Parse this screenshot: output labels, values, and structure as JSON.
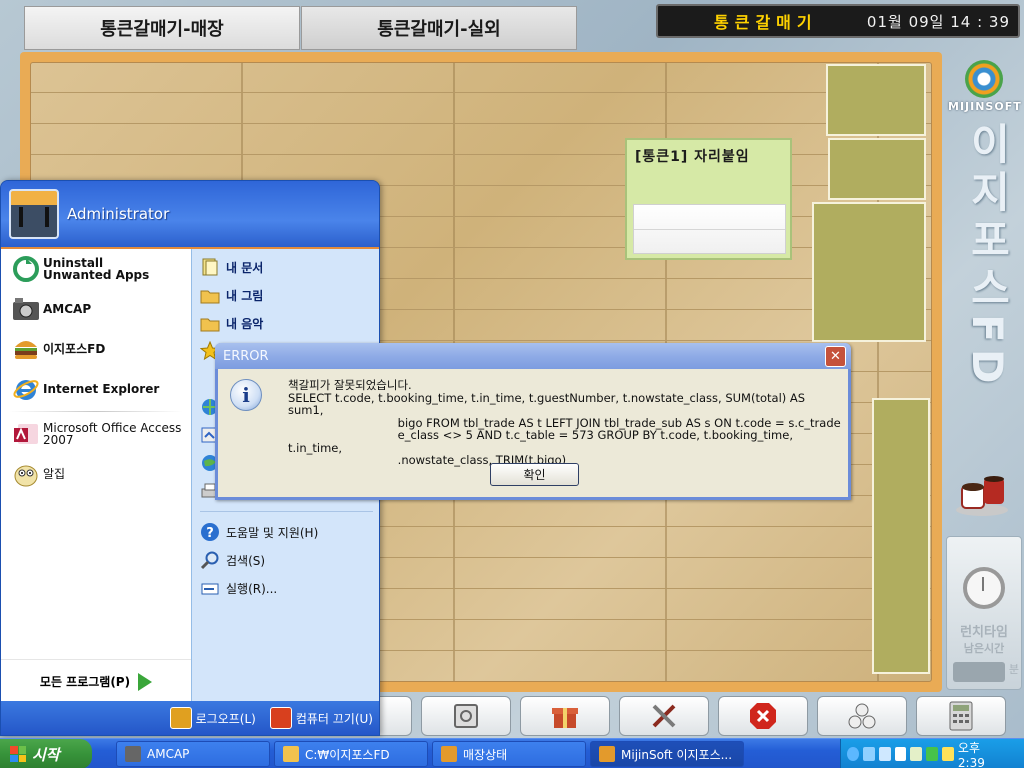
{
  "app": {
    "tabs": [
      "통큰갈매기-매장",
      "통큰갈매기-실외"
    ],
    "clock": {
      "store_name": "통큰갈매기",
      "date_time": "01월 09일  14 : 39"
    },
    "table": {
      "title": "[통큰1]   자리붙임"
    },
    "brand": {
      "name": "MIJINSOFT",
      "vertical_title": "이지포스FD"
    },
    "lunch": {
      "title": "런치타임",
      "subtitle": "남은시간",
      "unit": "분"
    },
    "toolbar_icons": [
      "box-icon",
      "safe-icon",
      "gift-icon",
      "tools-icon",
      "cancel-icon",
      "people-icon",
      "calculator-icon"
    ]
  },
  "start_menu": {
    "user": "Administrator",
    "left_items": [
      {
        "label": "Uninstall Unwanted Apps",
        "icon": "uninstall-icon"
      },
      {
        "label": "AMCAP",
        "icon": "camera-icon"
      },
      {
        "label": "이지포스FD",
        "icon": "burger-icon"
      },
      {
        "label": "Internet Explorer",
        "icon": "ie-icon"
      },
      {
        "label": "Microsoft Office Access 2007",
        "icon": "access-icon"
      },
      {
        "label": "알집",
        "icon": "alzip-icon"
      }
    ],
    "all_programs": "모든 프로그램(P)",
    "right_items": [
      {
        "label": "내 문서",
        "icon": "documents-icon"
      },
      {
        "label": "내 그림",
        "icon": "pictures-icon"
      },
      {
        "label": "내 음악",
        "icon": "music-icon"
      },
      {
        "label": "도움말 및 지원(H)",
        "icon": "help-icon"
      },
      {
        "label": "검색(S)",
        "icon": "search-icon"
      },
      {
        "label": "실행(R)...",
        "icon": "run-icon"
      }
    ],
    "logoff": "로그오프(L)",
    "shutdown": "컴퓨터 끄기(U)"
  },
  "dialog": {
    "title": "ERROR",
    "message": "책갈피가 잘못되었습니다.\nSELECT t.code, t.booking_time, t.in_time, t.guestNumber, t.nowstate_class, SUM(total) AS sum1,\n                              bigo FROM tbl_trade AS t LEFT JOIN tbl_trade_sub AS s ON t.code = s.c_trade\n                              e_class <> 5 AND t.c_table = 573 GROUP BY t.code, t.booking_time, t.in_time,\n                              .nowstate_class, TRIM(t.bigo)",
    "ok": "확인"
  },
  "taskbar": {
    "start": "시작",
    "tasks": [
      {
        "label": "AMCAP",
        "icon": "camera-icon"
      },
      {
        "label": "C:₩이지포스FD",
        "icon": "folder-icon"
      },
      {
        "label": "매장상태",
        "icon": "burger-icon"
      },
      {
        "label": "MijinSoft 이지포스...",
        "icon": "burger-icon"
      }
    ],
    "time": "오후 2:39"
  }
}
